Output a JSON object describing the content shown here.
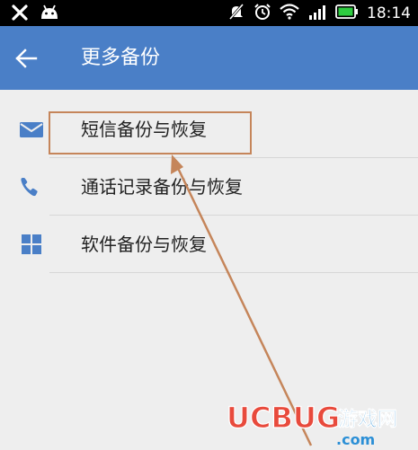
{
  "status_bar": {
    "time": "18:14"
  },
  "toolbar": {
    "title": "更多备份"
  },
  "menu": {
    "items": [
      {
        "label": "短信备份与恢复",
        "icon": "mail-icon"
      },
      {
        "label": "通话记录备份与恢复",
        "icon": "phone-icon"
      },
      {
        "label": "软件备份与恢复",
        "icon": "apps-grid-icon"
      }
    ]
  },
  "watermark": {
    "brand": "UCBUG",
    "tagline": "游戏网",
    "domain": ".com"
  },
  "colors": {
    "accent": "#4a7fc7",
    "status_bar": "#000000",
    "background": "#eeeeee",
    "highlight": "#c5855a",
    "icon": "#4a7fc7"
  }
}
